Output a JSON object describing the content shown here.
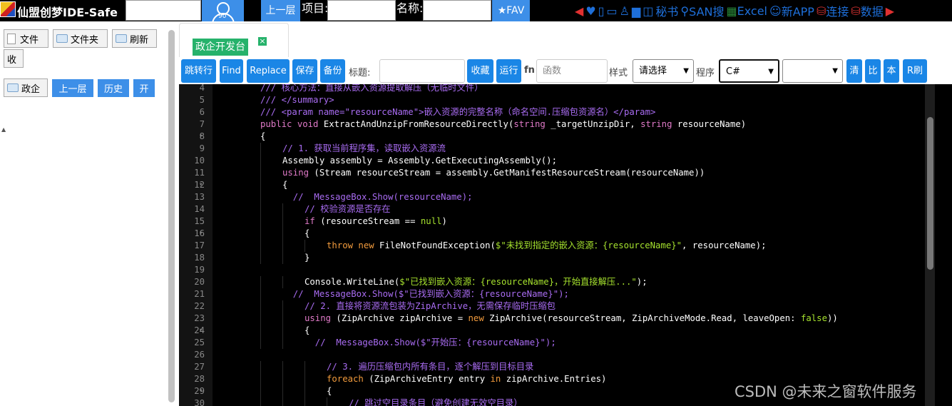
{
  "topbar": {
    "app_title": "仙盟创梦IDE-Safe",
    "avatar_num": "90",
    "up_label": "上一层",
    "project_label": "项目:",
    "name_label": "名称:",
    "fav_label": "★FAV",
    "icons": [
      {
        "icon": "play-left-icon",
        "text": "◀"
      },
      {
        "icon": "heart-icon",
        "text": "♥"
      },
      {
        "icon": "panel-icon",
        "text": "▯"
      },
      {
        "icon": "panel2-icon",
        "text": "▭"
      },
      {
        "icon": "user-icon",
        "text": "♙"
      },
      {
        "icon": "folder-icon",
        "text": "▆"
      },
      {
        "icon": "briefcase-icon",
        "text": "◫"
      }
    ],
    "secret_label": "秘书",
    "san_label": "SAN搜",
    "excel_label": "Excel",
    "newapp_label": "新APP",
    "connect_label": "连接",
    "data_label": "数据"
  },
  "sidebar": {
    "file_btn": "文件",
    "folder_btn": "文件夹",
    "refresh_btn": "刷新",
    "collapse_btn": "收",
    "gov_btn": "政企",
    "up_btn": "上一层",
    "history_btn": "历史",
    "open_btn": "开"
  },
  "tabs": [
    {
      "label": "政企开发台",
      "close": "×"
    }
  ],
  "toolbar": {
    "goto_btn": "跳转行",
    "find_btn": "Find",
    "replace_btn": "Replace",
    "save_btn": "保存",
    "backup_btn": "备份",
    "title_label": "标题:",
    "fav_btn": "收藏",
    "run_btn": "运行",
    "fn_label": "fn",
    "fn_placeholder": "函数",
    "style_label": "样式",
    "style_value": "请选择",
    "program_label": "程序",
    "lang_value": "C#",
    "clear_btn": "清",
    "compare_btn": "比",
    "local_btn": "本",
    "rbrush_btn": "R刷"
  },
  "editor": {
    "lines": [
      {
        "n": "4",
        "fold": "",
        "segs": [
          {
            "c": "cm",
            "t": "/// 核心方法：直接从嵌入资源提取解压（无临时文件）"
          }
        ],
        "indent": 0
      },
      {
        "n": "5",
        "fold": "",
        "segs": [
          {
            "c": "cm",
            "t": "/// </summary>"
          }
        ],
        "indent": 0
      },
      {
        "n": "6",
        "fold": "",
        "segs": [
          {
            "c": "cm",
            "t": "/// <param name=\"resourceName\">嵌入资源的完整名称（命名空间.压缩包资源名）</param>"
          }
        ],
        "indent": 0
      },
      {
        "n": "7",
        "fold": "",
        "segs": [
          {
            "c": "ty",
            "t": "public void "
          },
          {
            "c": "id",
            "t": "ExtractAndUnzipFromResourceDirectly("
          },
          {
            "c": "ty",
            "t": "string "
          },
          {
            "c": "id",
            "t": "_targetUnzipDir, "
          },
          {
            "c": "ty",
            "t": "string "
          },
          {
            "c": "id",
            "t": "resourceName)"
          }
        ],
        "indent": 0
      },
      {
        "n": "8",
        "fold": "▾",
        "segs": [
          {
            "c": "id",
            "t": "{"
          }
        ],
        "indent": 0
      },
      {
        "n": "9",
        "fold": "",
        "segs": [
          {
            "c": "cm",
            "t": "// 1. 获取当前程序集，读取嵌入资源流"
          }
        ],
        "indent": 1
      },
      {
        "n": "10",
        "fold": "",
        "segs": [
          {
            "c": "id",
            "t": "Assembly assembly = Assembly.GetExecutingAssembly();"
          }
        ],
        "indent": 1
      },
      {
        "n": "11",
        "fold": "",
        "segs": [
          {
            "c": "ty",
            "t": "using "
          },
          {
            "c": "id",
            "t": "(Stream resourceStream = assembly.GetManifestResourceStream(resourceName))"
          }
        ],
        "indent": 1
      },
      {
        "n": "12",
        "fold": "▾",
        "segs": [
          {
            "c": "id",
            "t": "{"
          }
        ],
        "indent": 1
      },
      {
        "n": "13",
        "fold": "",
        "segs": [
          {
            "c": "cm",
            "t": "  //  MessageBox.Show(resourceName);"
          }
        ],
        "indent": 1
      },
      {
        "n": "14",
        "fold": "",
        "segs": [
          {
            "c": "cm",
            "t": "// 校验资源是否存在"
          }
        ],
        "indent": 2
      },
      {
        "n": "15",
        "fold": "",
        "segs": [
          {
            "c": "ty",
            "t": "if "
          },
          {
            "c": "id",
            "t": "(resourceStream == "
          },
          {
            "c": "st",
            "t": "null"
          },
          {
            "c": "id",
            "t": ")"
          }
        ],
        "indent": 2
      },
      {
        "n": "16",
        "fold": "▾",
        "segs": [
          {
            "c": "id",
            "t": "{"
          }
        ],
        "indent": 2
      },
      {
        "n": "17",
        "fold": "",
        "segs": [
          {
            "c": "kw",
            "t": "throw new "
          },
          {
            "c": "id",
            "t": "FileNotFoundException("
          },
          {
            "c": "st",
            "t": "$\"未找到指定的嵌入资源：{resourceName}\""
          },
          {
            "c": "id",
            "t": ", resourceName);"
          }
        ],
        "indent": 3
      },
      {
        "n": "18",
        "fold": "",
        "segs": [
          {
            "c": "id",
            "t": "}"
          }
        ],
        "indent": 2
      },
      {
        "n": "19",
        "fold": "",
        "segs": [
          {
            "c": "id",
            "t": ""
          }
        ],
        "indent": 0
      },
      {
        "n": "20",
        "fold": "",
        "segs": [
          {
            "c": "id",
            "t": "Console.WriteLine("
          },
          {
            "c": "st",
            "t": "$\"已找到嵌入资源：{resourceName}，开始直接解压...\""
          },
          {
            "c": "id",
            "t": ");"
          }
        ],
        "indent": 2
      },
      {
        "n": "21",
        "fold": "",
        "segs": [
          {
            "c": "cm",
            "t": "  //  MessageBox.Show($\"已找到嵌入资源：{resourceName}\");"
          }
        ],
        "indent": 1
      },
      {
        "n": "22",
        "fold": "",
        "segs": [
          {
            "c": "cm",
            "t": "// 2. 直接将资源流包装为ZipArchive，无需保存临时压缩包"
          }
        ],
        "indent": 2
      },
      {
        "n": "23",
        "fold": "",
        "segs": [
          {
            "c": "ty",
            "t": "using "
          },
          {
            "c": "id",
            "t": "(ZipArchive zipArchive = "
          },
          {
            "c": "kw",
            "t": "new "
          },
          {
            "c": "id",
            "t": "ZipArchive(resourceStream, ZipArchiveMode.Read, leaveOpen: "
          },
          {
            "c": "st",
            "t": "false"
          },
          {
            "c": "id",
            "t": "))"
          }
        ],
        "indent": 2
      },
      {
        "n": "24",
        "fold": "▾",
        "segs": [
          {
            "c": "id",
            "t": "{"
          }
        ],
        "indent": 2
      },
      {
        "n": "25",
        "fold": "",
        "segs": [
          {
            "c": "cm",
            "t": "  //  MessageBox.Show($\"开始压：{resourceName}\");"
          }
        ],
        "indent": 2
      },
      {
        "n": "26",
        "fold": "",
        "segs": [
          {
            "c": "id",
            "t": ""
          }
        ],
        "indent": 0
      },
      {
        "n": "27",
        "fold": "",
        "segs": [
          {
            "c": "cm",
            "t": "// 3. 遍历压缩包内所有条目，逐个解压到目标目录"
          }
        ],
        "indent": 3
      },
      {
        "n": "28",
        "fold": "",
        "segs": [
          {
            "c": "kw",
            "t": "foreach "
          },
          {
            "c": "id",
            "t": "(ZipArchiveEntry entry "
          },
          {
            "c": "kw",
            "t": "in "
          },
          {
            "c": "id",
            "t": "zipArchive.Entries)"
          }
        ],
        "indent": 3
      },
      {
        "n": "29",
        "fold": "▾",
        "segs": [
          {
            "c": "id",
            "t": "{"
          }
        ],
        "indent": 3
      },
      {
        "n": "30",
        "fold": "",
        "segs": [
          {
            "c": "cm",
            "t": "// 跳过空目录条目（避免创建无效空目录）"
          }
        ],
        "indent": 4
      }
    ]
  },
  "watermark": "CSDN @未来之窗软件服务"
}
